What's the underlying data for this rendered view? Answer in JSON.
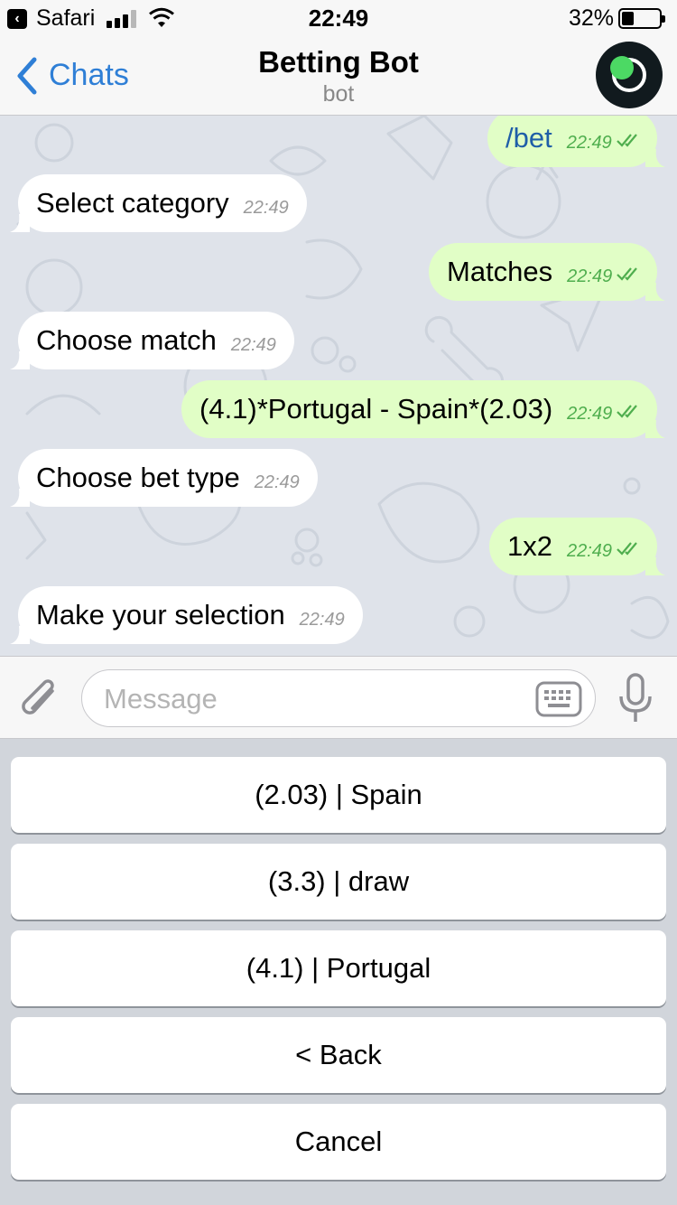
{
  "status_bar": {
    "back_app": "Safari",
    "time": "22:49",
    "battery_percent": "32%",
    "battery_level": 0.32,
    "signal_bars": 3
  },
  "nav": {
    "back_label": "Chats",
    "title": "Betting Bot",
    "subtitle": "bot"
  },
  "messages": [
    {
      "direction": "out",
      "text": "/bet",
      "time": "22:49",
      "is_command": true
    },
    {
      "direction": "in",
      "text": "Select category",
      "time": "22:49"
    },
    {
      "direction": "out",
      "text": "Matches",
      "time": "22:49"
    },
    {
      "direction": "in",
      "text": "Choose match",
      "time": "22:49"
    },
    {
      "direction": "out",
      "text": "(4.1)*Portugal - Spain*(2.03)",
      "time": "22:49"
    },
    {
      "direction": "in",
      "text": "Choose bet type",
      "time": "22:49"
    },
    {
      "direction": "out",
      "text": "1x2",
      "time": "22:49"
    },
    {
      "direction": "in",
      "text": "Make your selection",
      "time": "22:49"
    }
  ],
  "input": {
    "placeholder": "Message",
    "value": ""
  },
  "keyboard_buttons": [
    {
      "label": "(2.03) | Spain"
    },
    {
      "label": "(3.3) | draw"
    },
    {
      "label": "(4.1) | Portugal"
    },
    {
      "label": "< Back"
    },
    {
      "label": "Cancel"
    }
  ],
  "colors": {
    "accent": "#2f7fd6",
    "outgoing_bubble": "#e1fec6",
    "incoming_bubble": "#ffffff",
    "read_ticks": "#4fae4e",
    "online_dot": "#4cd964"
  }
}
